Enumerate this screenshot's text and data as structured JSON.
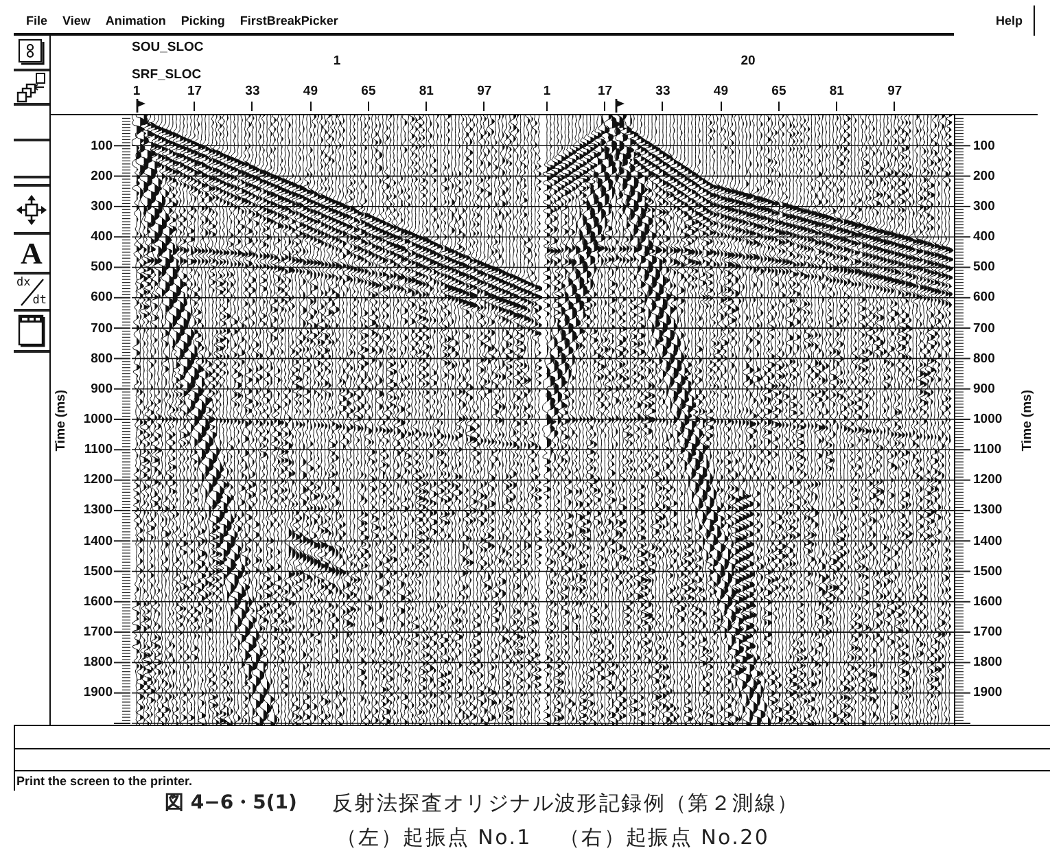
{
  "menu_bar": {
    "items": [
      {
        "label": "File"
      },
      {
        "label": "View"
      },
      {
        "label": "Animation"
      },
      {
        "label": "Picking"
      },
      {
        "label": "FirstBreakPicker"
      }
    ],
    "help": {
      "label": "Help"
    }
  },
  "toolbar": {
    "text_button": "A",
    "derivative_button": {
      "numerator": "dx",
      "denominator": "dt"
    }
  },
  "record_header": {
    "source_key": "SOU_SLOC",
    "receiver_key": "SRF_SLOC"
  },
  "gathers": [
    {
      "source": "1",
      "traces": [
        "1",
        "17",
        "33",
        "49",
        "65",
        "81",
        "97"
      ]
    },
    {
      "source": "20",
      "traces": [
        "1",
        "17",
        "33",
        "49",
        "65",
        "81",
        "97"
      ]
    }
  ],
  "left_axis": {
    "title": "Time (ms)",
    "ticks": [
      "100",
      "200",
      "300",
      "400",
      "500",
      "600",
      "700",
      "800",
      "900",
      "1000",
      "1100",
      "1200",
      "1300",
      "1400",
      "1500",
      "1600",
      "1700",
      "1800",
      "1900"
    ]
  },
  "right_axis": {
    "title": "Time (ms)",
    "ticks": [
      "100",
      "200",
      "300",
      "400",
      "500",
      "600",
      "700",
      "800",
      "900",
      "1000",
      "1100",
      "1200",
      "1300",
      "1400",
      "1500",
      "1600",
      "1700",
      "1800",
      "1900"
    ]
  },
  "status_bar": {
    "message": "Print the screen to the printer."
  },
  "caption": {
    "number": "図 4−6・5(1)",
    "title": "反射法探査オリジナル波形記録例（第２測線）",
    "subtitle": [
      "（左）起振点 No.1",
      "（右）起振点 No.20"
    ]
  }
}
